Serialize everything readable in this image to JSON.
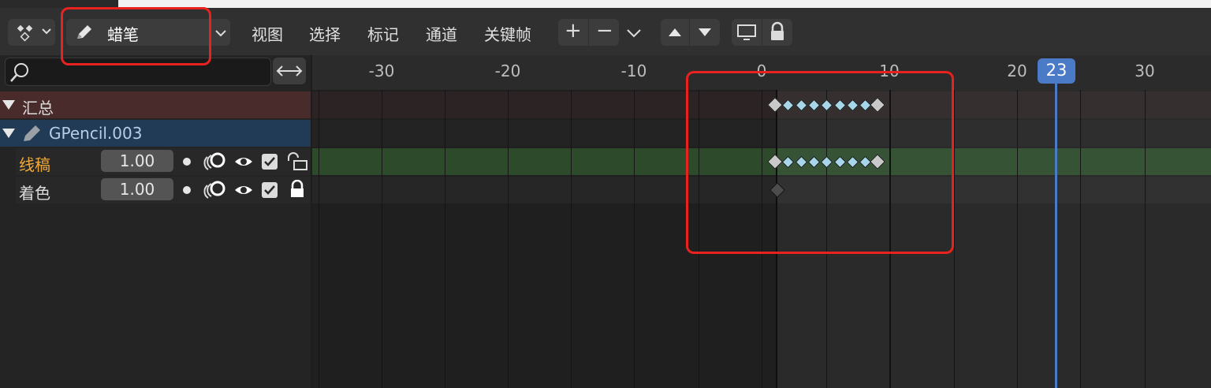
{
  "header": {
    "mode_label": "蜡笔",
    "menus": [
      "视图",
      "选择",
      "标记",
      "通道",
      "关键帧"
    ],
    "plus": "+",
    "minus": "−"
  },
  "ruler": {
    "ticks": [
      "-30",
      "-20",
      "-10",
      "0",
      "10",
      "20",
      "30"
    ],
    "current_frame": "23"
  },
  "channels": {
    "summary": "汇总",
    "object": "GPencil.003",
    "layers": [
      {
        "name": "线稿",
        "value": "1.00",
        "color": "#f2a93b"
      },
      {
        "name": "着色",
        "value": "1.00",
        "color": "#dcdcdc"
      }
    ]
  },
  "colors": {
    "highlight": "#e8231f",
    "playhead": "#4b7ac7",
    "summary_bg": "#4a2b2c",
    "object_bg": "#213a56",
    "active_bg": "#2d4a2b"
  }
}
